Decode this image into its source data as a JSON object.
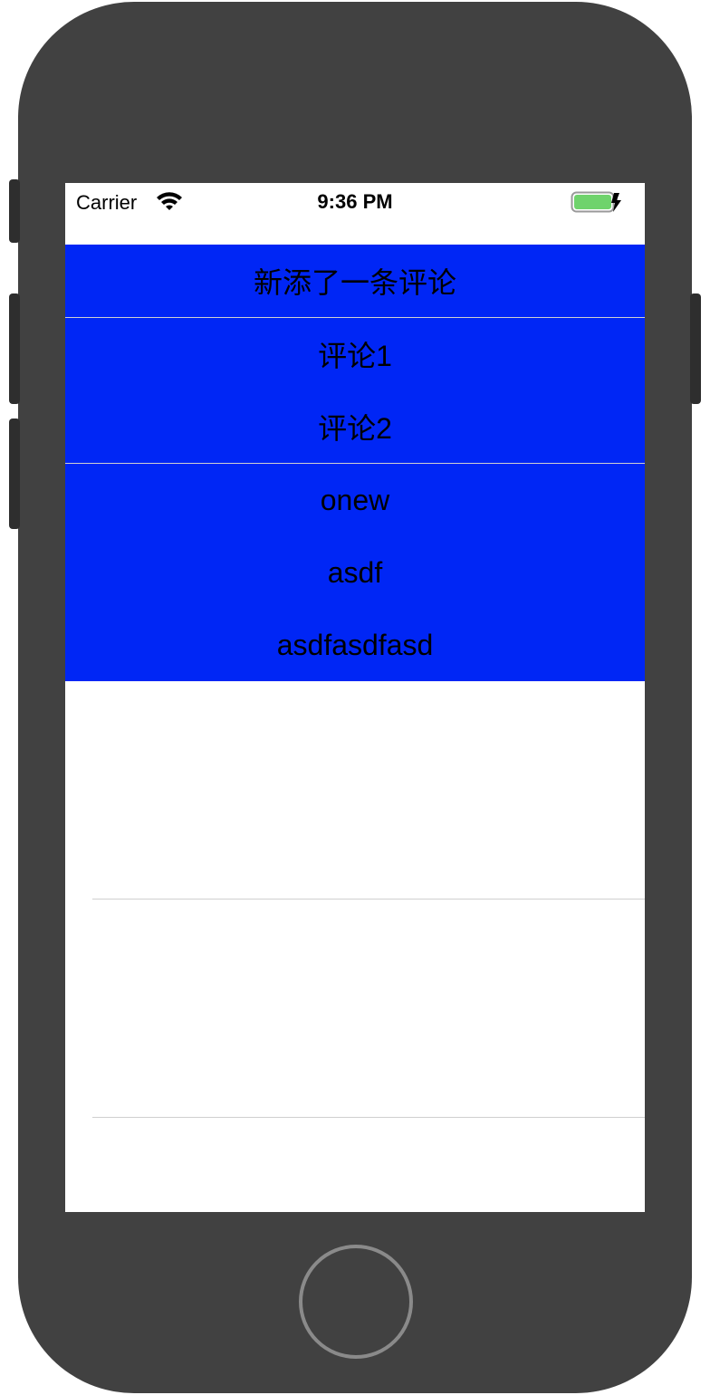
{
  "status_bar": {
    "carrier": "Carrier",
    "time": "9:36 PM"
  },
  "comments": [
    {
      "text": "新添了一条评论"
    },
    {
      "text": "评论1"
    },
    {
      "text": "评论2"
    },
    {
      "text": "onew"
    },
    {
      "text": "asdf"
    },
    {
      "text": "asdfasdfasd"
    }
  ],
  "colors": {
    "cell_background": "#0026f5",
    "device_frame": "#414141",
    "battery_fill": "#6fd36c"
  }
}
